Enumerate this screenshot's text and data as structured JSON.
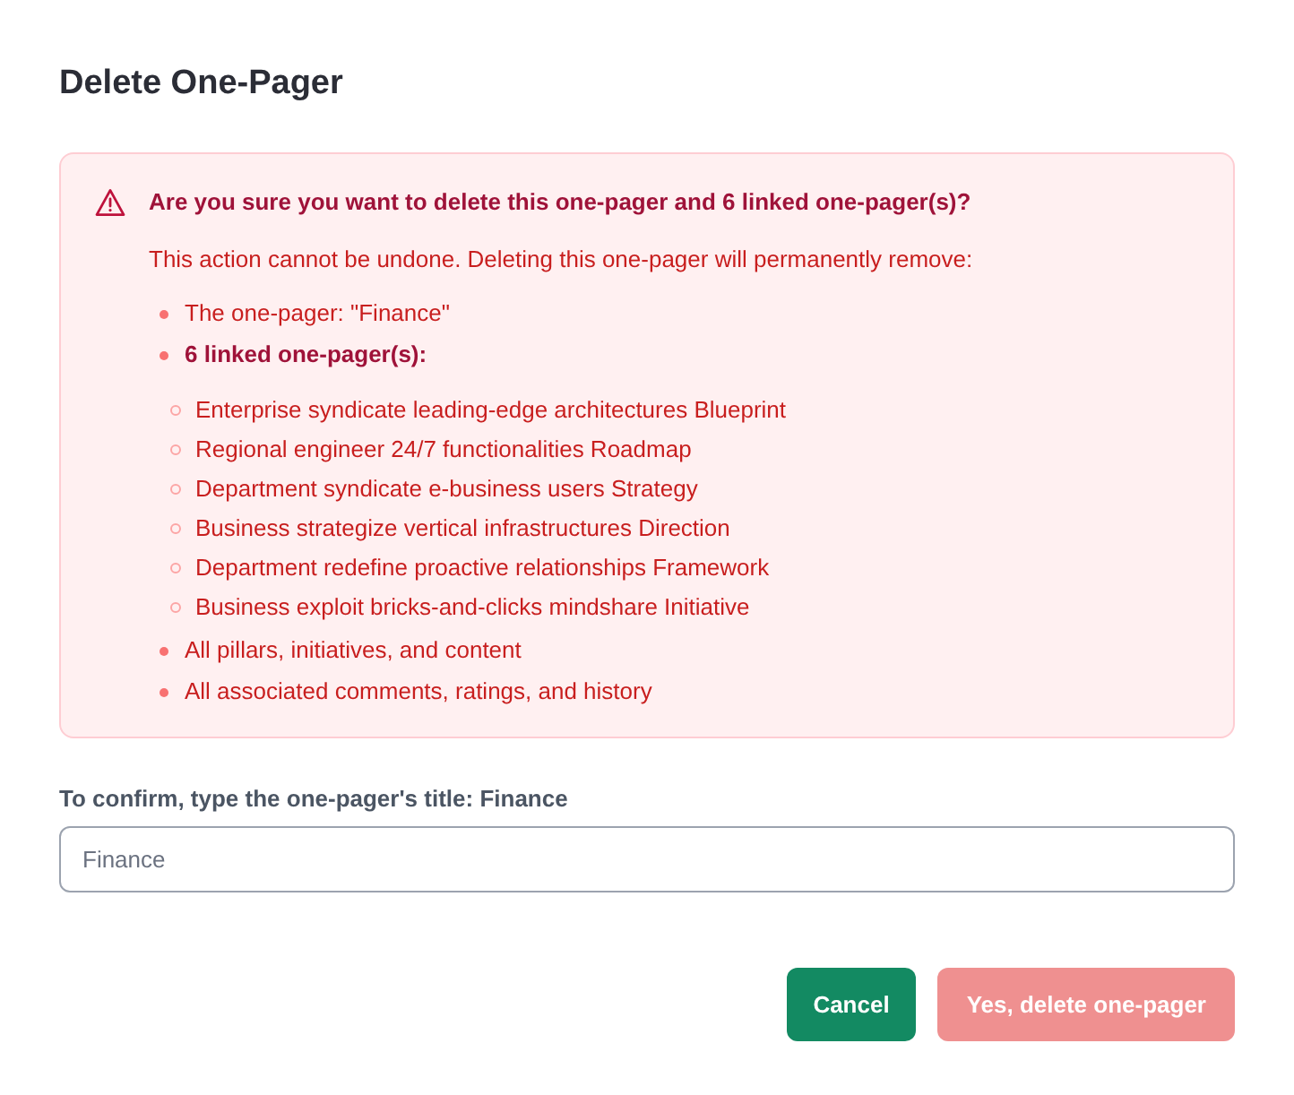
{
  "dialog": {
    "title": "Delete One-Pager"
  },
  "warning": {
    "heading": "Are you sure you want to delete this one-pager and 6 linked one-pager(s)?",
    "intro": "This action cannot be undone. Deleting this one-pager will permanently remove:",
    "items": [
      {
        "kind": "item",
        "text": "The one-pager: \"Finance\""
      },
      {
        "kind": "group",
        "text": "6 linked one-pager(s):",
        "children": [
          {
            "text": "Enterprise syndicate leading-edge architectures Blueprint"
          },
          {
            "text": "Regional engineer 24/7 functionalities Roadmap"
          },
          {
            "text": "Department syndicate e-business users Strategy"
          },
          {
            "text": "Business strategize vertical infrastructures Direction"
          },
          {
            "text": "Department redefine proactive relationships Framework"
          },
          {
            "text": "Business exploit bricks-and-clicks mindshare Initiative"
          }
        ]
      },
      {
        "kind": "item",
        "text": "All pillars, initiatives, and content"
      },
      {
        "kind": "item",
        "text": "All associated comments, ratings, and history"
      }
    ]
  },
  "confirm": {
    "label": "To confirm, type the one-pager's title: Finance",
    "placeholder": "Finance"
  },
  "buttons": [
    {
      "kind": "cancel",
      "label": "Cancel",
      "disabled": false
    },
    {
      "kind": "danger",
      "label": "Yes, delete one-pager",
      "disabled": true
    }
  ]
}
